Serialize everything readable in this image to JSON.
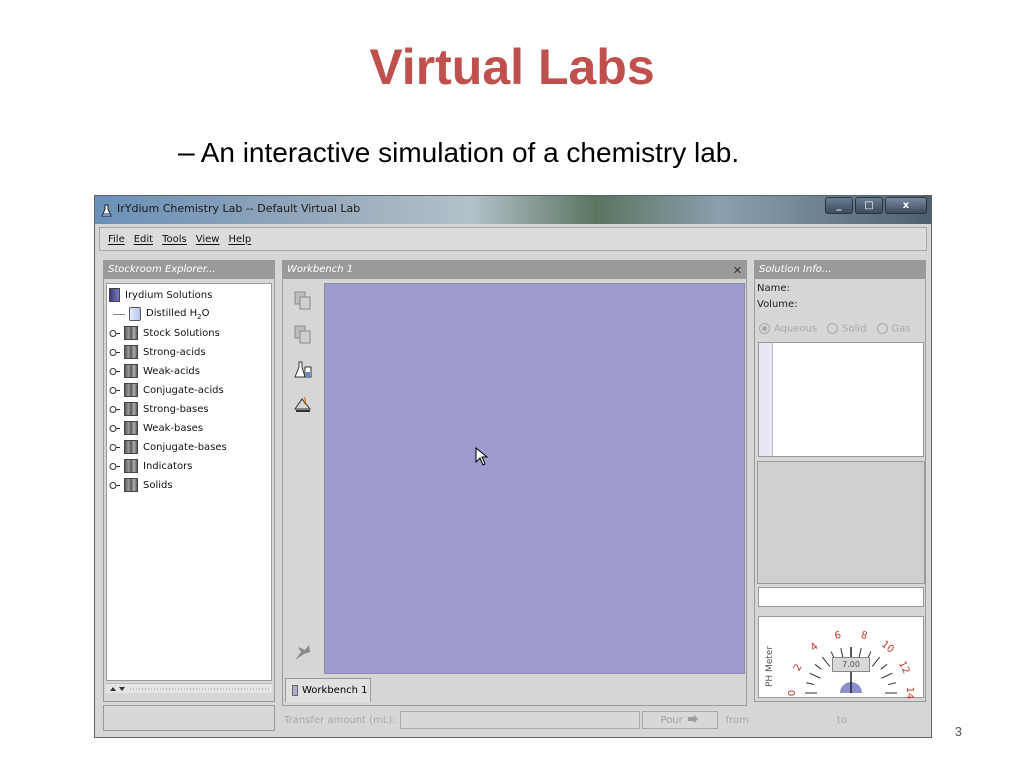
{
  "slide": {
    "title": "Virtual Labs",
    "bullet_dash": "–",
    "bullet": "An interactive simulation of a chemistry lab.",
    "page_number": "3"
  },
  "window": {
    "title": "IrYdium Chemistry Lab -- Default Virtual Lab",
    "minimize": "_",
    "maximize": "□",
    "close": "x"
  },
  "menu": [
    {
      "label": "File"
    },
    {
      "label": "Edit"
    },
    {
      "label": "Tools"
    },
    {
      "label": "View"
    },
    {
      "label": "Help"
    }
  ],
  "stockroom": {
    "header": "Stockroom Explorer...",
    "root": "Irydium Solutions",
    "distilled": {
      "prefix": "Distilled H",
      "sub": "2",
      "suffix": "O"
    },
    "items": [
      "Stock Solutions",
      "Strong-acids",
      "Weak-acids",
      "Conjugate-acids",
      "Strong-bases",
      "Weak-bases",
      "Conjugate-bases",
      "Indicators",
      "Solids"
    ]
  },
  "workbench": {
    "header": "Workbench 1",
    "close": "✕",
    "tab_label": "Workbench 1",
    "canvas_color": "#9e9ccf"
  },
  "transfer": {
    "label": "Transfer amount (mL):",
    "pour": "Pour",
    "from": "from",
    "to": "to"
  },
  "solution_info": {
    "header": "Solution Info...",
    "name_label": "Name:",
    "volume_label": "Volume:",
    "phases": [
      {
        "label": "Aqueous",
        "selected": true
      },
      {
        "label": "Solid",
        "selected": false
      },
      {
        "label": "Gas",
        "selected": false
      }
    ]
  },
  "ph_meter": {
    "label": "PH Meter",
    "reading": "7.00",
    "scale": [
      "0",
      "2",
      "4",
      "6",
      "8",
      "10",
      "12",
      "14"
    ],
    "needle_value": 7
  },
  "colors": {
    "title_red": "#c0504d",
    "workbench_purple": "#9e9ccf",
    "scale_red": "#c0392b",
    "gauge_base": "#8e90cc"
  }
}
